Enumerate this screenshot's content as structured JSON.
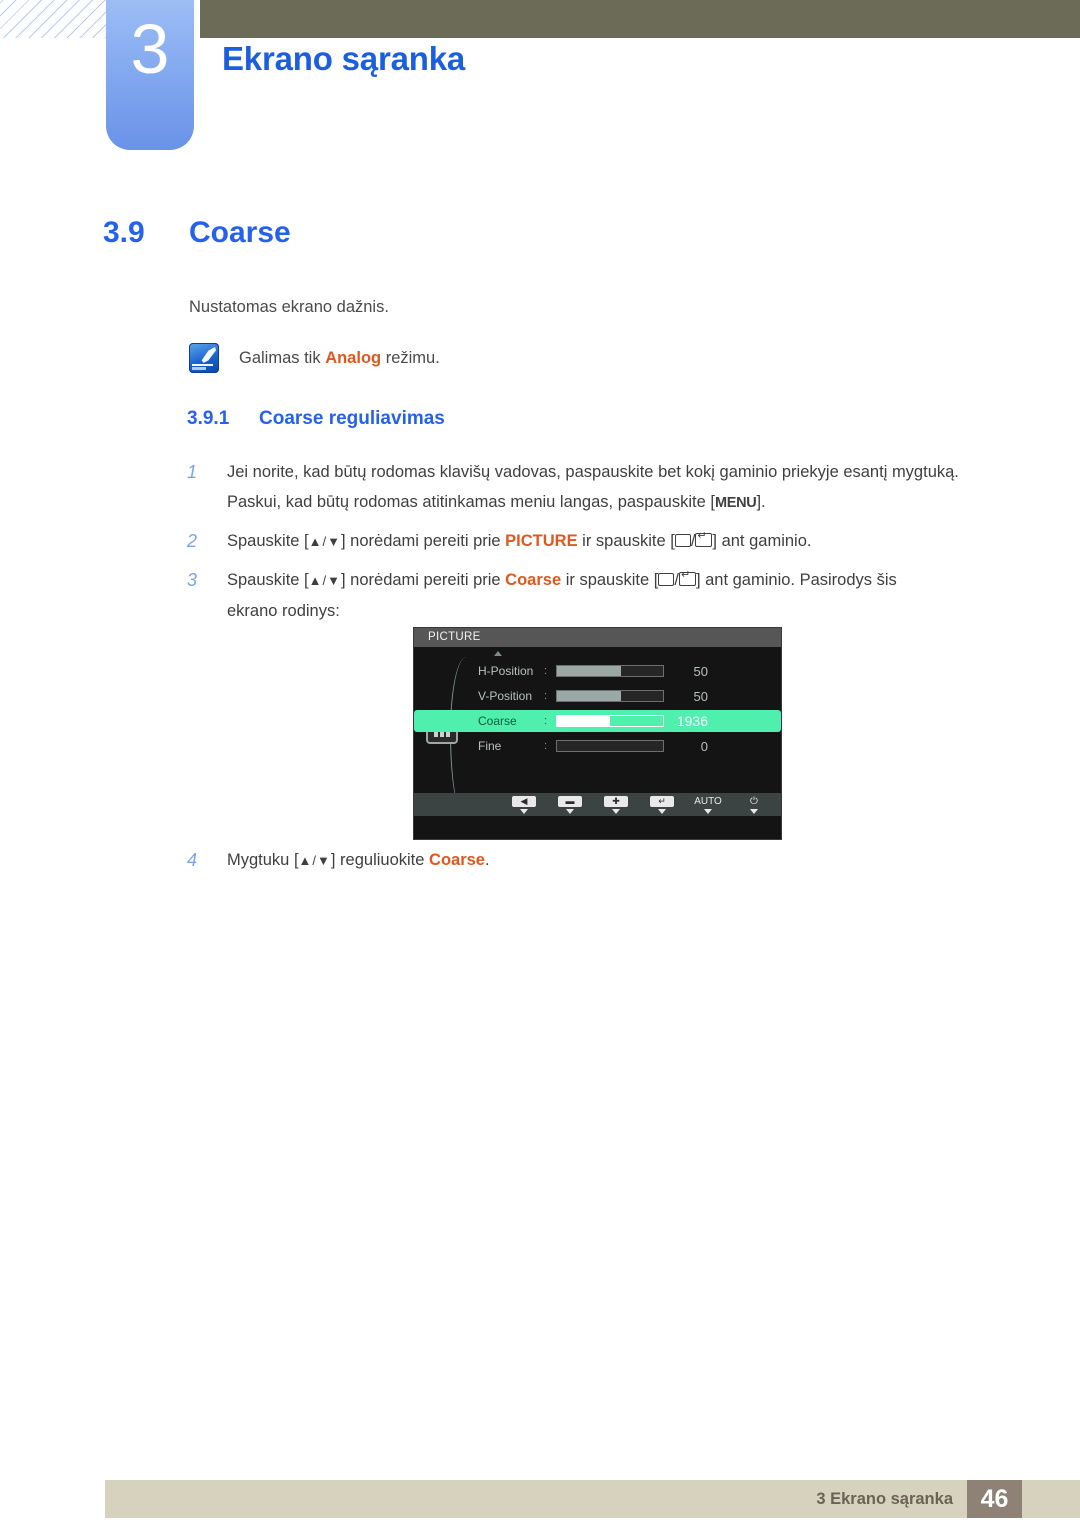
{
  "header": {
    "chapter_number": "3",
    "chapter_title": "Ekrano sąranka",
    "bar_color": "#6b6b58",
    "badge_color": "#84aaf0",
    "title_color": "#1a5fe0"
  },
  "section": {
    "number": "3.9",
    "title": "Coarse",
    "intro": "Nustatomas ekrano dažnis.",
    "note": {
      "icon": "note-pen-icon",
      "prefix": "Galimas tik ",
      "highlight": "Analog",
      "suffix": " režimu.",
      "highlight_color": "#e2571e"
    },
    "subsection": {
      "number": "3.9.1",
      "title": "Coarse reguliavimas"
    }
  },
  "steps": [
    {
      "num": "1",
      "line1_a": "Jei norite, kad būtų rodomas klavišų vadovas, paspauskite bet kokį gaminio priekyje esantį mygtuką.",
      "line2_a": "Paskui, kad būtų rodomas atitinkamas meniu langas, paspauskite [",
      "menu_key": "MENU",
      "line2_b": "]."
    },
    {
      "num": "2",
      "a": "Spauskite [",
      "keys": "▲/▼",
      "b": "] norėdami pereiti prie ",
      "highlight": "PICTURE",
      "c": " ir spauskite [",
      "d": "/",
      "e": "] ant gaminio."
    },
    {
      "num": "3",
      "a": "Spauskite [",
      "keys": "▲/▼",
      "b": "] norėdami pereiti prie ",
      "highlight": "Coarse",
      "c": " ir spauskite [",
      "d": "/",
      "e": "] ant gaminio. Pasirodys šis",
      "line2": "ekrano rodinys:"
    },
    {
      "num": "4",
      "a": "Mygtuku [",
      "keys": "▲/▼",
      "b": "] reguliuokite ",
      "highlight": "Coarse",
      "c": "."
    }
  ],
  "osd": {
    "title": "PICTURE",
    "category_icon": "picture-bars-icon",
    "scroll_up_icon": "scroll-up-arrow-icon",
    "highlight_color": "#4ff0ad",
    "rows": [
      {
        "label": "H-Position",
        "value": "50",
        "fill_percent": 60,
        "selected": false
      },
      {
        "label": "V-Position",
        "value": "50",
        "fill_percent": 60,
        "selected": false
      },
      {
        "label": "Coarse",
        "value": "1936",
        "fill_percent": 50,
        "selected": true
      },
      {
        "label": "Fine",
        "value": "0",
        "fill_percent": 0,
        "selected": false
      }
    ],
    "footer_buttons": [
      {
        "name": "back-button",
        "glyph": "◀",
        "plain": false
      },
      {
        "name": "minus-button",
        "glyph": "▬",
        "plain": false
      },
      {
        "name": "plus-button",
        "glyph": "✚",
        "plain": false
      },
      {
        "name": "enter-button",
        "glyph": "↵",
        "plain": false
      },
      {
        "name": "auto-button",
        "glyph": "AUTO",
        "plain": true
      },
      {
        "name": "power-button",
        "glyph": "⏻",
        "plain": true
      }
    ]
  },
  "footer": {
    "text": "3 Ekrano sąranka",
    "page": "46",
    "bar_color": "#d7d2bd",
    "page_box_color": "#8e8276"
  }
}
